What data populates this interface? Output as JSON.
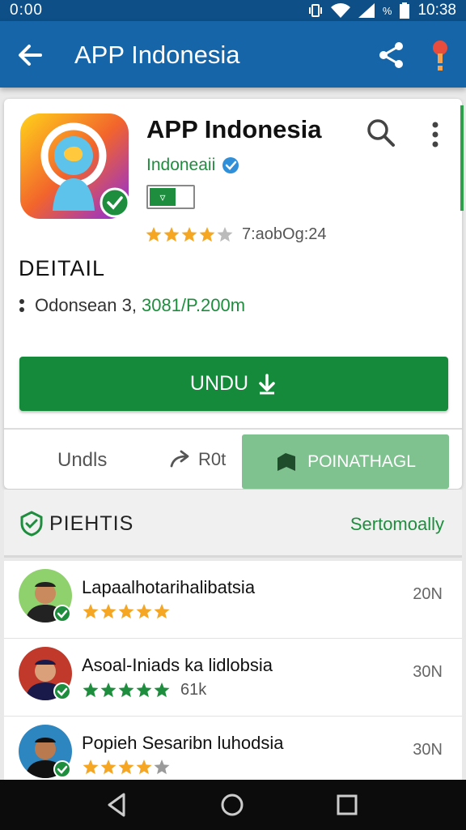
{
  "status_bar": {
    "time_left": "0:00",
    "battery_label": "%",
    "time_right": "10:38"
  },
  "app_bar": {
    "title": "APP Indonesia"
  },
  "app": {
    "name": "APP Indonesia",
    "developer": "Indoneaii",
    "toggle_label": "▿",
    "rating_count": "7:aobOg:24",
    "rating": 4
  },
  "details": {
    "section_title": "DEITAIL",
    "meta_text": "Odonsean 3,",
    "meta_size": "3081/P.200m"
  },
  "install_button": {
    "label": "UNDU"
  },
  "tabs": {
    "tab_a": "Undls",
    "tab_b": "R0t",
    "tab_c": "POINATHAGL"
  },
  "reviews": {
    "title": "PIEHTIS",
    "link": "Sertomoally",
    "items": [
      {
        "name": "Lapaalhotarihalibatsia",
        "stars": 5,
        "star_color": "#f5a623",
        "extra": "",
        "value": "20N"
      },
      {
        "name": "Asoal-Iniads ka lidlobsia",
        "stars": 5,
        "star_color": "#1e8e3e",
        "extra": "61k",
        "value": "30N"
      },
      {
        "name": "Popieh Sesaribn luhodsia",
        "stars": 4,
        "star_color": "#f5a623",
        "extra": "",
        "value": "30N"
      }
    ]
  },
  "colors": {
    "app_bar": "#1565a8",
    "status_bar": "#0d4f86",
    "primary_green": "#158a3a",
    "secondary_green": "#7fc18f"
  },
  "icons": [
    "back-arrow-icon",
    "share-icon",
    "location-pin-icon",
    "search-icon",
    "more-vert-icon",
    "verified-icon",
    "download-icon",
    "forward-icon",
    "bookmark-icon",
    "shield-check-icon",
    "nav-back-icon",
    "nav-home-icon",
    "nav-recents-icon"
  ]
}
